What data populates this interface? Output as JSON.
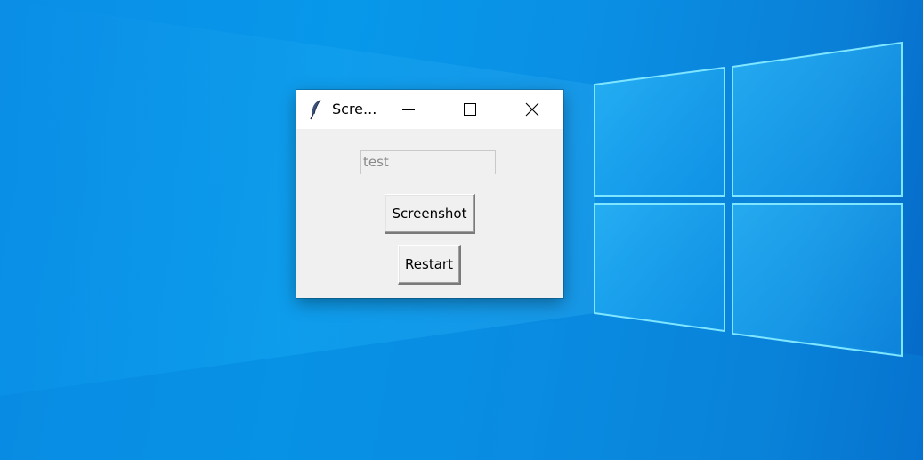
{
  "desktop": {
    "wallpaper_icon": "windows-logo-wallpaper",
    "background_color": "#0a8fe4"
  },
  "window": {
    "title": "Scre...",
    "app_icon": "feather-icon",
    "controls": {
      "minimize_icon": "minimize-icon",
      "maximize_icon": "maximize-icon",
      "close_icon": "close-icon"
    },
    "entry": {
      "value": "test"
    },
    "buttons": {
      "screenshot_label": "Screenshot",
      "restart_label": "Restart"
    },
    "colors": {
      "titlebar": "#ffffff",
      "client": "#f0f0f0"
    }
  }
}
